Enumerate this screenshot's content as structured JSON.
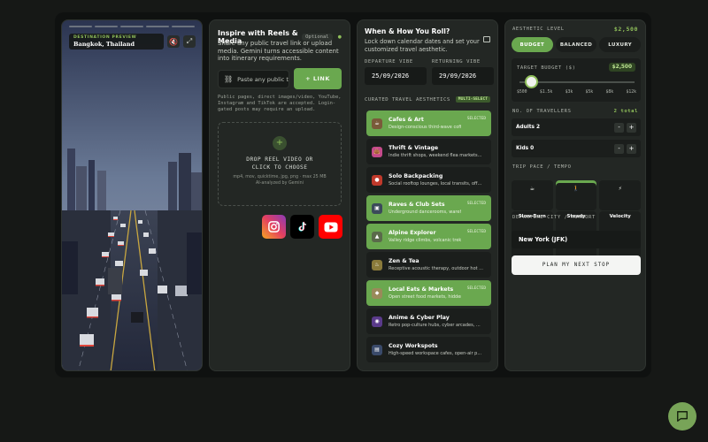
{
  "preview": {
    "label": "DESTINATION PREVIEW",
    "destination": "Bangkok, Thailand",
    "mute_icon": "mute-icon",
    "expand_icon": "expand-icon",
    "progress_segments": 5
  },
  "inspire": {
    "title": "Inspire with Reels & Media",
    "optional_badge": "Optional",
    "description": "Share any public travel link or upload media. Gemini turns accessible content into itinerary requirements.",
    "link_placeholder": "Paste any public t",
    "link_button": "+ LINK",
    "note": "Public pages, direct images/video, YouTube, Instagram and TikTok are accepted. Login-gated posts may require an upload.",
    "drop_title": "DROP REEL VIDEO OR CLICK TO CHOOSE",
    "drop_sub": "mp4, mov, quicktime, jpg, png · max 25 MB\nAI-analyzed by Gemini",
    "socials": [
      "instagram",
      "tiktok",
      "youtube"
    ]
  },
  "when": {
    "title": "When & How You Roll?",
    "description": "Lock down calendar dates and set your customized travel aesthetic.",
    "departure_label": "DEPARTURE VIBE",
    "departure_value": "25/09/2026",
    "returning_label": "RETURNING VIBE",
    "returning_value": "29/09/2026",
    "curated_label": "CURATED TRAVEL AESTHETICS",
    "multi_badge": "MULTI-SELECT",
    "aesthetics": [
      {
        "name": "Cafes & Art",
        "sub": "Design-conscious third-wave coffee, gall...",
        "selected": true,
        "badge": "SELECTED",
        "icon": "☕",
        "color": "#7a5a3a"
      },
      {
        "name": "Thrift & Vintage",
        "sub": "Indie thrift shops, weekend flea markets...",
        "selected": false,
        "badge": "",
        "icon": "👜",
        "color": "#c44a8a"
      },
      {
        "name": "Solo Backpacking",
        "sub": "Social rooftop lounges, local transits, off...",
        "selected": false,
        "badge": "",
        "icon": "●",
        "color": "#c0392b"
      },
      {
        "name": "Raves & Club Sets",
        "sub": "Underground dancerooms, warehouse t...",
        "selected": true,
        "badge": "SELECTED",
        "icon": "▣",
        "color": "#3b4a5a"
      },
      {
        "name": "Alpine Explorer",
        "sub": "Valley ridge climbs, volcanic treks, wond...",
        "selected": true,
        "badge": "SELECTED",
        "icon": "▲",
        "color": "#5a6a4a"
      },
      {
        "name": "Zen & Tea",
        "sub": "Receptive acoustic therapy, outdoor hot ...",
        "selected": false,
        "badge": "",
        "icon": "♨",
        "color": "#8a7a3a"
      },
      {
        "name": "Local Eats & Markets",
        "sub": "Open street food markets, hidden bass...",
        "selected": true,
        "badge": "SELECTED",
        "icon": "◆",
        "color": "#9a8a5a"
      },
      {
        "name": "Anime & Cyber Play",
        "sub": "Retro pop-culture hubs, cyber arcades, ...",
        "selected": false,
        "badge": "",
        "icon": "◉",
        "color": "#5a3a8a"
      },
      {
        "name": "Cozy Workspots",
        "sub": "High-speed workspace cafes, open-air p...",
        "selected": false,
        "badge": "",
        "icon": "▤",
        "color": "#3a4a6a"
      }
    ]
  },
  "aesthetic_level": {
    "label": "AESTHETIC LEVEL",
    "amount": "$2,500",
    "options": [
      "BUDGET",
      "BALANCED",
      "LUXURY"
    ],
    "selected": "BUDGET",
    "target_label": "TARGET BUDGET ($)",
    "target_value": "$2,500",
    "slider_level": 0.1,
    "ticks": [
      "$500",
      "$1.5k",
      "$3k",
      "$5k",
      "$8k",
      "$12k"
    ]
  },
  "travellers": {
    "label": "NO. OF TRAVELLERS",
    "total": "2 total",
    "rows": [
      {
        "name": "Adults 2",
        "minus": "-",
        "plus": "+"
      },
      {
        "name": "Kids 0",
        "minus": "-",
        "plus": "+"
      }
    ]
  },
  "pace": {
    "label": "TRIP PACE / TEMPO",
    "options": [
      {
        "icon": "☕",
        "name": "Slow-Burn",
        "sub": "Mindful pace",
        "selected": false
      },
      {
        "icon": "🚶",
        "name": "Steady",
        "sub": "Balanced rhythm",
        "selected": true
      },
      {
        "icon": "⚡",
        "name": "Velocity",
        "sub": "High intensity",
        "selected": false
      }
    ]
  },
  "departure_city": {
    "label": "DEPARTURE CITY / AIRPORT",
    "value": "New York (JFK)"
  },
  "plan_button": "PLAN MY NEXT STOP",
  "colors": {
    "accent": "#6aa84f",
    "panel": "#232724",
    "background": "#161816"
  }
}
